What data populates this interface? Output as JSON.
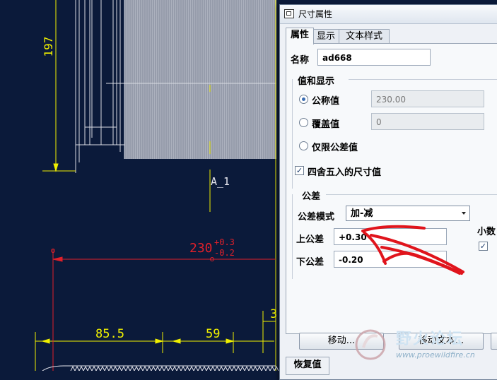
{
  "cad": {
    "dim_197": "197",
    "datum_a": "A_1",
    "dim_230": "230",
    "tol_plus_small": "+0.3",
    "tol_minus_small": "-0.2",
    "dim_85_5": "85.5",
    "dim_59": "59",
    "dim_3": "3",
    "line_color": "#f0f000",
    "red_color": "#e0202a",
    "bg_color": "#0b1a3a"
  },
  "dialog": {
    "title": "尺寸属性",
    "tabs": [
      "属性",
      "显示",
      "文本样式"
    ],
    "active_tab": "属性",
    "name_label": "名称",
    "name_value": "ad668",
    "value_group_label": "值和显示",
    "nominal_label": "公称值",
    "nominal_value": "230.00",
    "override_label": "覆盖值",
    "override_value": "0",
    "tol_only_label": "仅限公差值",
    "round_label": "四舍五入的尺寸值",
    "round_checked": true,
    "tolerance_group_label": "公差",
    "tol_mode_label": "公差模式",
    "tol_mode_value": "加-减",
    "upper_label": "上公差",
    "upper_value": "+0.30",
    "lower_label": "下公差",
    "lower_value": "-0.20",
    "decimal_label": "小数",
    "move_button": "移动...",
    "move_text_button": "移动文本...",
    "restore_tab": "恢复值"
  },
  "watermark": {
    "title": "野火论坛",
    "url": "www.proewildfire.cn"
  }
}
